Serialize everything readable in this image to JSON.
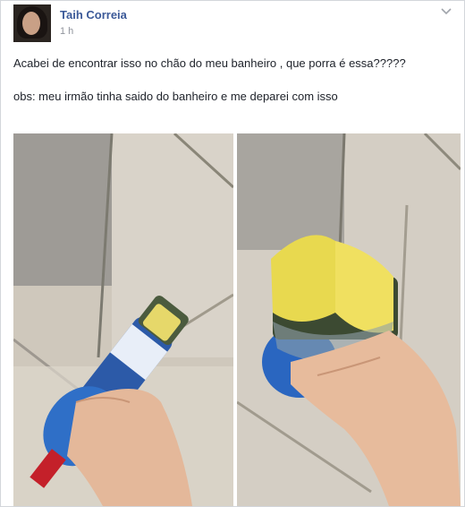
{
  "post": {
    "author": "Taih Correia",
    "time": "1 h",
    "chevron_icon": "chevron-down-icon",
    "text_line1": "Acabei de encontrar isso no chão do meu banheiro , que porra é essa?????",
    "text_line2": "obs: meu irmão tinha saido do banheiro e me deparei com isso"
  },
  "photos": [
    {
      "name": "photo-left"
    },
    {
      "name": "photo-right"
    }
  ]
}
